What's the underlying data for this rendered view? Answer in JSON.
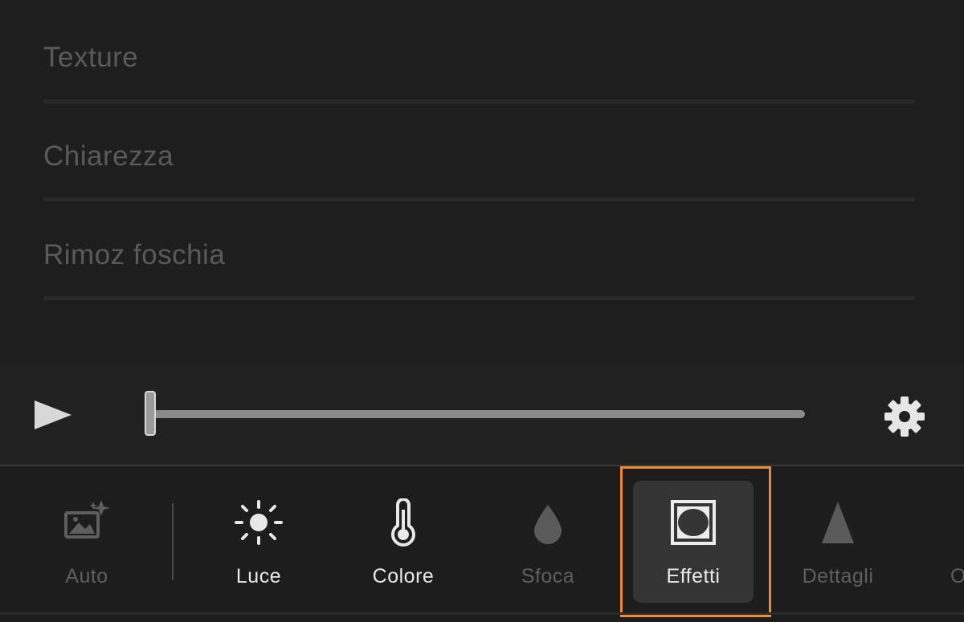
{
  "adjustments": {
    "items": [
      {
        "label": "Texture"
      },
      {
        "label": "Chiarezza"
      },
      {
        "label": "Rimoz foschia"
      }
    ]
  },
  "playback": {
    "progress": 0
  },
  "toolbar": {
    "tools": [
      {
        "label": "Auto",
        "icon": "auto-enhance-icon",
        "state": "disabled"
      },
      {
        "label": "Luce",
        "icon": "sun-icon",
        "state": "enabled"
      },
      {
        "label": "Colore",
        "icon": "thermometer-icon",
        "state": "enabled"
      },
      {
        "label": "Sfoca",
        "icon": "drop-icon",
        "state": "disabled"
      },
      {
        "label": "Effetti",
        "icon": "vignette-icon",
        "state": "selected"
      },
      {
        "label": "Dettagli",
        "icon": "triangle-icon",
        "state": "disabled"
      },
      {
        "label": "O",
        "icon": "partial-icon",
        "state": "disabled"
      }
    ]
  },
  "colors": {
    "highlight": "#f08a33",
    "selected_bg": "#353535",
    "background": "#1c1c1c"
  }
}
